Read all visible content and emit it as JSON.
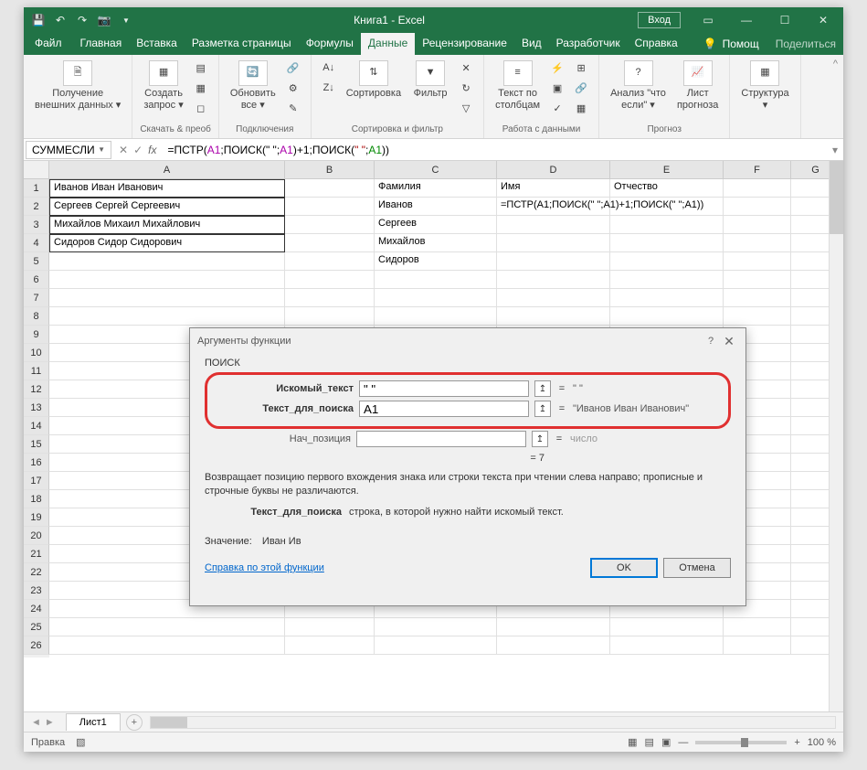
{
  "title": "Книга1  -  Excel",
  "signin": "Вход",
  "tabs": {
    "file": "Файл",
    "items": [
      "Главная",
      "Вставка",
      "Разметка страницы",
      "Формулы",
      "Данные",
      "Рецензирование",
      "Вид",
      "Разработчик",
      "Справка"
    ],
    "active_index": 4,
    "tell_me": "Помощ",
    "share": "Поделиться"
  },
  "ribbon": {
    "g1": {
      "btn1": "Получение\nвнешних данных ▾",
      "label": ""
    },
    "g2": {
      "btn1": "Создать\nзапрос ▾",
      "label": "Скачать & преоб"
    },
    "g3": {
      "btn1": "Обновить\nвсе ▾",
      "label": "Подключения"
    },
    "g4": {
      "btn1": "Сортировка",
      "btn2": "Фильтр",
      "label": "Сортировка и фильтр"
    },
    "g5": {
      "btn1": "Текст по\nстолбцам",
      "label": "Работа с данными"
    },
    "g6": {
      "btn1": "Анализ \"что\nесли\" ▾",
      "btn2": "Лист\nпрогноза",
      "label": "Прогноз"
    },
    "g7": {
      "btn1": "Структура\n▾",
      "label": ""
    }
  },
  "name_box": "СУММЕСЛИ",
  "formula": "=ПСТР(A1;ПОИСК(\" \";A1)+1;ПОИСК(\" \";A1))",
  "columns": [
    "A",
    "B",
    "C",
    "D",
    "E",
    "F",
    "G"
  ],
  "cells": {
    "A1": "Иванов Иван Иванович",
    "A2": "Сергеев Сергей Сергеевич",
    "A3": "Михайлов Михаил Михайлович",
    "A4": "Сидоров Сидор Сидорович",
    "C1": "Фамилия",
    "D1": "Имя",
    "E1": "Отчество",
    "C2": "Иванов",
    "D2": "=ПСТР(A1;ПОИСК(\" \";A1)+1;ПОИСК(\" \";A1))",
    "C3": "Сергеев",
    "C4": "Михайлов",
    "C5": "Сидоров"
  },
  "dialog": {
    "title": "Аргументы функции",
    "fn": "ПОИСК",
    "arg1_label": "Искомый_текст",
    "arg1_value": "\" \"",
    "arg1_result": "\" \"",
    "arg2_label": "Текст_для_поиска",
    "arg2_value": "A1",
    "arg2_result": "\"Иванов Иван Иванович\"",
    "arg3_label": "Нач_позиция",
    "arg3_value": "",
    "arg3_result": "число",
    "result": "=  7",
    "desc": "Возвращает позицию первого вхождения знака или строки текста при чтении слева направо; прописные и строчные буквы не различаются.",
    "param_name": "Текст_для_поиска",
    "param_desc": "строка, в которой нужно найти искомый текст.",
    "value_label": "Значение:",
    "value": "Иван Ив",
    "link": "Справка по этой функции",
    "ok": "OK",
    "cancel": "Отмена"
  },
  "sheet": "Лист1",
  "status": "Правка",
  "zoom": "100 %",
  "chart_data": null
}
